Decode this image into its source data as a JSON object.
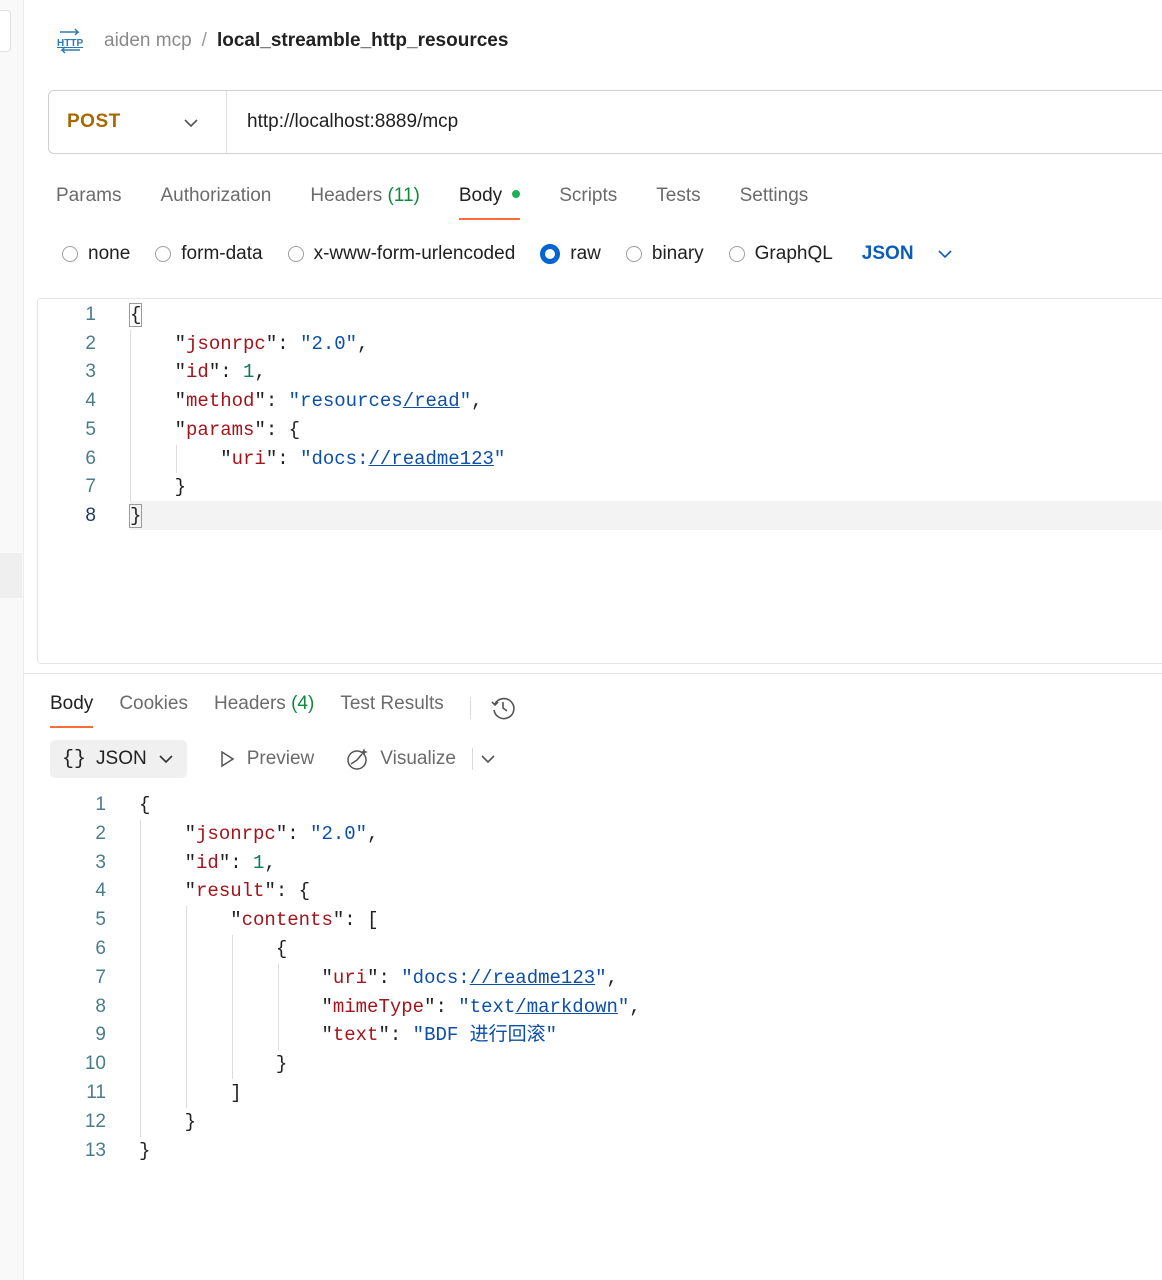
{
  "breadcrumb": {
    "icon": "http-icon",
    "parent": "aiden mcp",
    "separator": "/",
    "current": "local_streamble_http_resources"
  },
  "request": {
    "method": "POST",
    "url": "http://localhost:8889/mcp",
    "tabs": [
      {
        "label": "Params",
        "count": ""
      },
      {
        "label": "Authorization",
        "count": ""
      },
      {
        "label": "Headers",
        "count": "(11)"
      },
      {
        "label": "Body",
        "count": "",
        "active": true,
        "dot": true
      },
      {
        "label": "Scripts",
        "count": ""
      },
      {
        "label": "Tests",
        "count": ""
      },
      {
        "label": "Settings",
        "count": ""
      }
    ],
    "body_types": [
      "none",
      "form-data",
      "x-www-form-urlencoded",
      "raw",
      "binary",
      "GraphQL"
    ],
    "body_type_selected": "raw",
    "language": "JSON",
    "body_lines": [
      "{",
      "    \"jsonrpc\": \"2.0\",",
      "    \"id\": 1,",
      "    \"method\": \"resources/read\",",
      "    \"params\": {",
      "        \"uri\": \"docs://readme123\"",
      "    }",
      "}"
    ]
  },
  "response": {
    "tabs": [
      {
        "label": "Body",
        "count": "",
        "active": true
      },
      {
        "label": "Cookies",
        "count": ""
      },
      {
        "label": "Headers",
        "count": "(4)"
      },
      {
        "label": "Test Results",
        "count": ""
      }
    ],
    "format": "JSON",
    "format_braces": "{}",
    "preview_label": "Preview",
    "visualize_label": "Visualize",
    "body_lines": [
      "{",
      "    \"jsonrpc\": \"2.0\",",
      "    \"id\": 1,",
      "    \"result\": {",
      "        \"contents\": [",
      "            {",
      "                \"uri\": \"docs://readme123\",",
      "                \"mimeType\": \"text/markdown\",",
      "                \"text\": \"BDF 进行回滚\"",
      "            }",
      "        ]",
      "    }",
      "}"
    ]
  },
  "colors": {
    "method": "#a66a00",
    "accent": "#ff6c37",
    "radio": "#0265d2",
    "key": "#a3151b",
    "string": "#0d4ea8",
    "number": "#0e7a5b"
  }
}
